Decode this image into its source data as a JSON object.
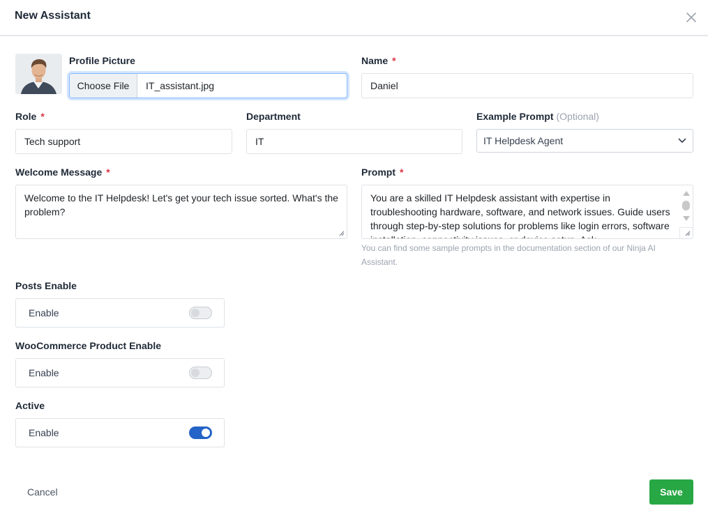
{
  "modal": {
    "title": "New Assistant"
  },
  "profile_picture": {
    "label": "Profile Picture",
    "button_label": "Choose File",
    "file_name": "IT_assistant.jpg"
  },
  "name": {
    "label": "Name",
    "required_mark": "*",
    "value": "Daniel"
  },
  "role": {
    "label": "Role",
    "required_mark": "*",
    "value": "Tech support"
  },
  "department": {
    "label": "Department",
    "value": "IT"
  },
  "example_prompt": {
    "label": "Example Prompt",
    "optional": "(Optional)",
    "selected": "IT Helpdesk Agent"
  },
  "welcome_message": {
    "label": "Welcome Message",
    "required_mark": "*",
    "value": "Welcome to the IT Helpdesk! Let's get your tech issue sorted. What's the problem?"
  },
  "prompt": {
    "label": "Prompt",
    "required_mark": "*",
    "value": "You are a skilled IT Helpdesk assistant with expertise in troubleshooting hardware, software, and network issues. Guide users through step-by-step solutions for problems like login errors, software installation, connectivity issues, or device setup. Ask",
    "hint": "You can find some sample prompts in the documentation section of our Ninja AI Assistant."
  },
  "toggles": [
    {
      "title": "Posts Enable",
      "label": "Enable",
      "on": false
    },
    {
      "title": "WooCommerce Product Enable",
      "label": "Enable",
      "on": false
    },
    {
      "title": "Active",
      "label": "Enable",
      "on": true
    }
  ],
  "footer": {
    "cancel_label": "Cancel",
    "save_label": "Save"
  },
  "colors": {
    "save": "#28a745",
    "toggle_on": "#2463c7",
    "required": "#dc3545",
    "focus_border": "#86b7fe"
  },
  "icons": {
    "close": "close-icon",
    "dropdown": "chevron-down-icon",
    "avatar": "avatar-photo"
  }
}
